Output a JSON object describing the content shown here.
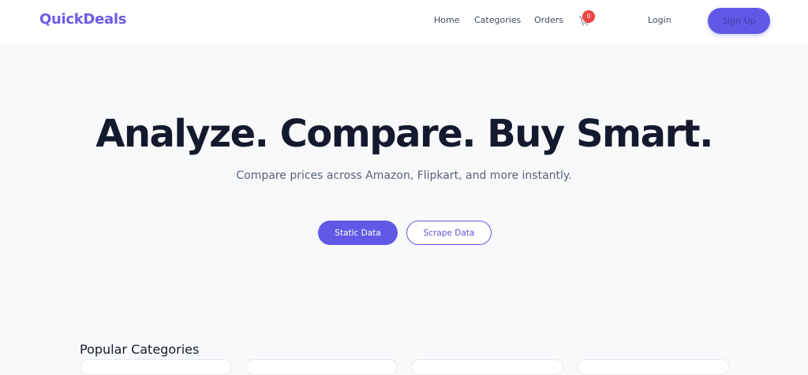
{
  "header": {
    "brand": "QuickDeals",
    "nav": {
      "home": "Home",
      "categories": "Categories",
      "orders": "Orders"
    },
    "cart": {
      "icon": "cart-icon",
      "count": "0"
    },
    "login": "Login",
    "signup": "Sign Up"
  },
  "hero": {
    "title": "Analyze. Compare. Buy Smart.",
    "subtitle": "Compare prices across Amazon, Flipkart, and more instantly.",
    "primary_button": "Static Data",
    "secondary_button": "Scrape Data"
  },
  "categories": {
    "title": "Popular Categories"
  },
  "colors": {
    "brand": "#6b5ce7",
    "accent": "#6159e6",
    "badge": "#ef4444",
    "heading": "#141a2e"
  }
}
